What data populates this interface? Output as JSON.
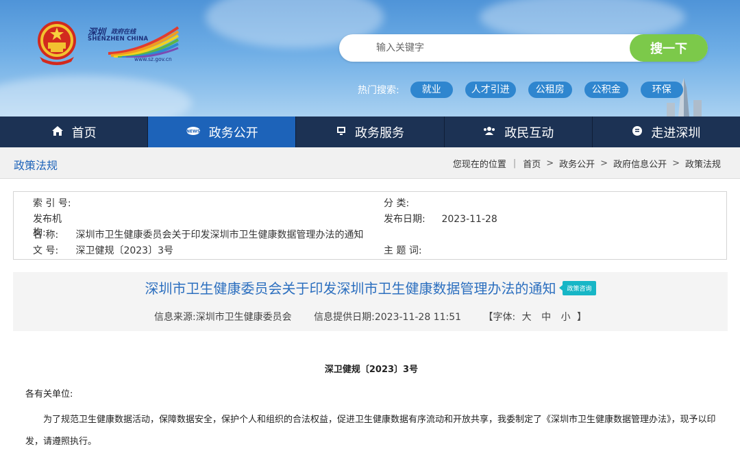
{
  "header": {
    "logo": {
      "name_cn": "深圳",
      "subtitle_cn": "政府在线",
      "name_en": "SHENZHEN CHINA",
      "url": "www.sz.gov.cn"
    },
    "search": {
      "placeholder": "输入关键字",
      "button_label": "搜一下"
    },
    "hot_label": "热门搜索:",
    "hot_tags": [
      "就业",
      "人才引进",
      "公租房",
      "公积金",
      "环保"
    ]
  },
  "nav": {
    "items": [
      {
        "label": "首页",
        "icon": "home-icon"
      },
      {
        "label": "政务公开",
        "icon": "news-icon"
      },
      {
        "label": "政务服务",
        "icon": "monitor-icon"
      },
      {
        "label": "政民互动",
        "icon": "people-icon"
      },
      {
        "label": "走进深圳",
        "icon": "chat-icon"
      }
    ],
    "active_index": 1
  },
  "breadcrumb_bar": {
    "section_title": "政策法规",
    "location_label": "您现在的位置",
    "crumbs": [
      "首页",
      "政务公开",
      "政府信息公开",
      "政策法规"
    ]
  },
  "meta": {
    "index_label": "索 引 号:",
    "index_value": "",
    "category_label": "分 类:",
    "category_value": "",
    "publisher_label": "发布机构:",
    "publisher_value": "",
    "date_label": "发布日期:",
    "date_value": "2023-11-28",
    "name_label": "名 称:",
    "name_value": "深圳市卫生健康委员会关于印发深圳市卫生健康数据管理办法的通知",
    "docno_label": "文 号:",
    "docno_value": "深卫健规〔2023〕3号",
    "keywords_label": "主 题 词:",
    "keywords_value": ""
  },
  "article": {
    "title": "深圳市卫生健康委员会关于印发深圳市卫生健康数据管理办法的通知",
    "badge": "政策咨询",
    "source_label": "信息来源:",
    "source_value": "深圳市卫生健康委员会",
    "provided_label": "信息提供日期:",
    "provided_value": "2023-11-28 11:51",
    "font_label": "【字体:",
    "font_large": "大",
    "font_medium": "中",
    "font_small": "小",
    "font_close": "】",
    "doc_number": "深卫健规〔2023〕3号",
    "greeting": "各有关单位:",
    "paragraph": "为了规范卫生健康数据活动，保障数据安全，保护个人和组织的合法权益，促进卫生健康数据有序流动和开放共享，我委制定了《深圳市卫生健康数据管理办法》，现予以印发，请遵照执行。"
  },
  "colors": {
    "nav_bg": "#1c3254",
    "nav_active": "#1d63b9",
    "search_button": "#7cc94a",
    "hot_tag": "#2f86cf",
    "title_blue": "#2c6fbf",
    "badge": "#17b6c6"
  }
}
